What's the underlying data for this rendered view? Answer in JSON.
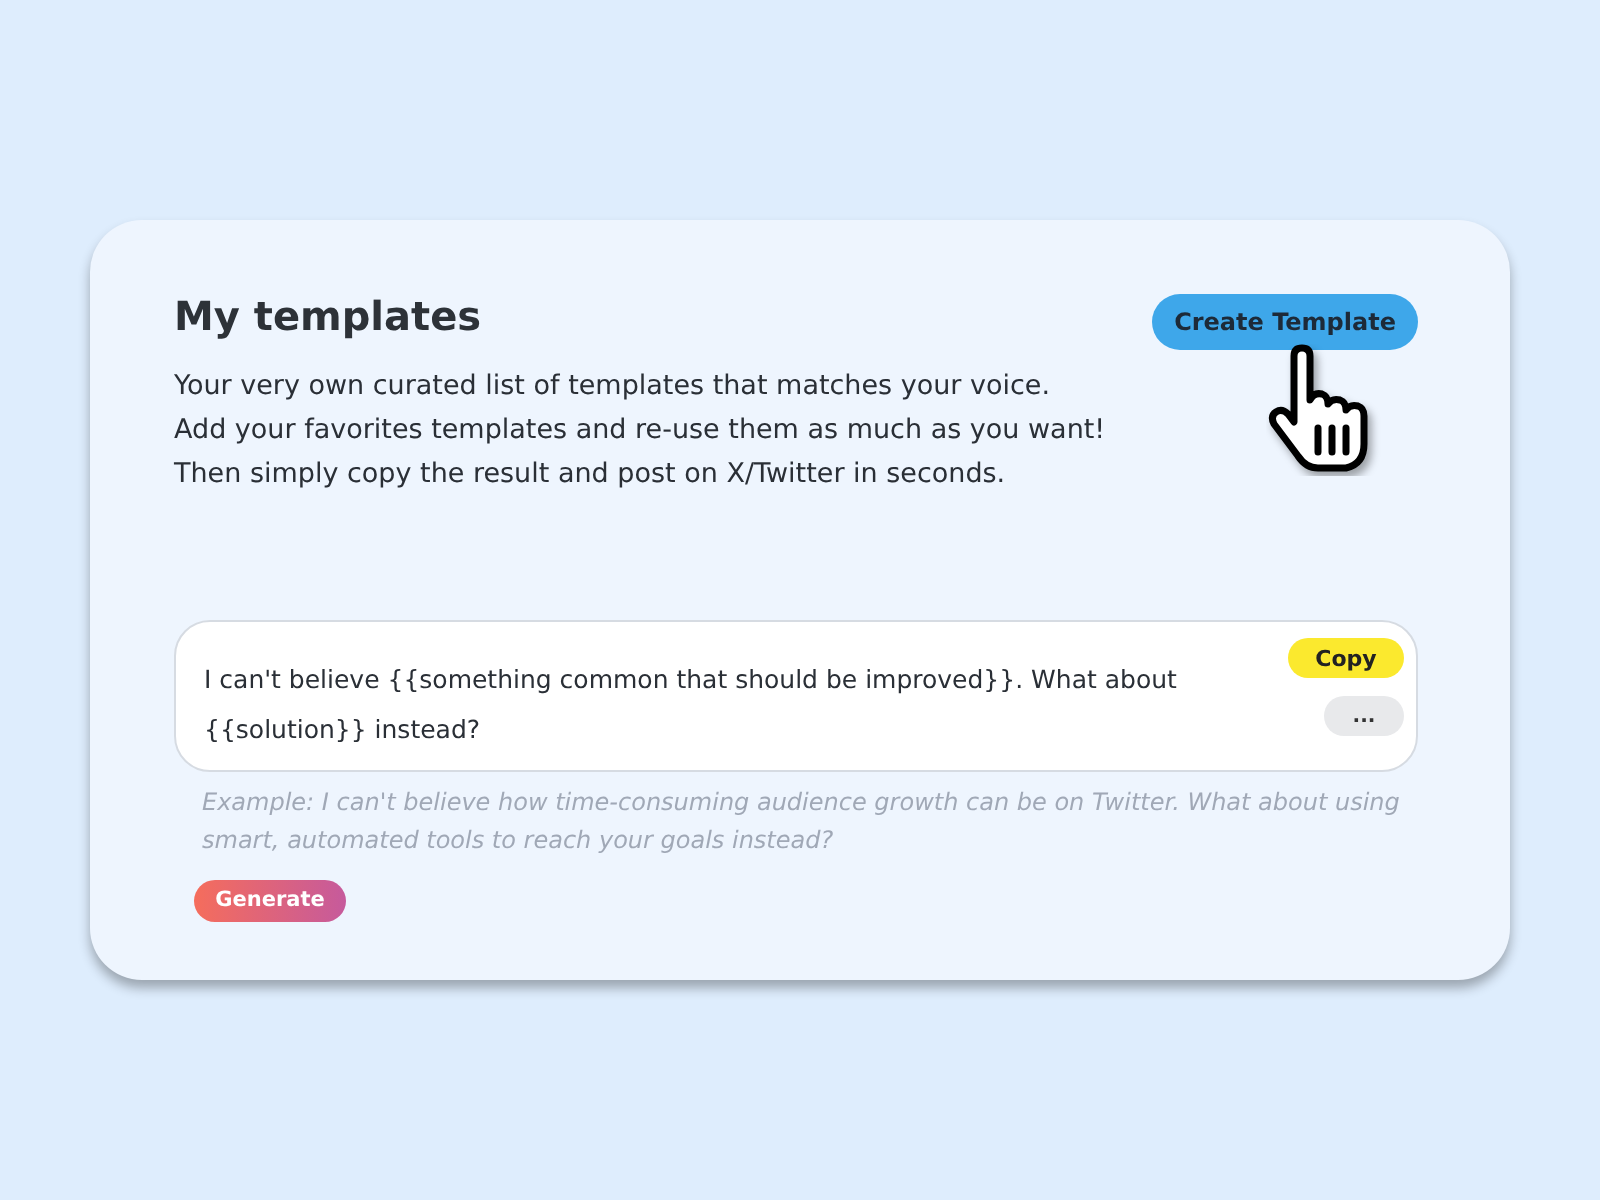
{
  "page": {
    "title": "My templates",
    "description": [
      "Your very own curated list of templates that matches your voice.",
      "Add your favorites templates and re-use them as much as you want!",
      "Then simply copy the result and post on X/Twitter in seconds."
    ],
    "create_button": "Create Template"
  },
  "templates": [
    {
      "text": "I can't believe {{something common that should be improved}}. What about {{solution}} instead?",
      "copy_button": "Copy",
      "more_button": "...",
      "example": "Example: I can't believe how time-consuming audience growth can be on Twitter. What about using smart, automated tools to reach your goals instead?",
      "generate_button": "Generate"
    }
  ]
}
